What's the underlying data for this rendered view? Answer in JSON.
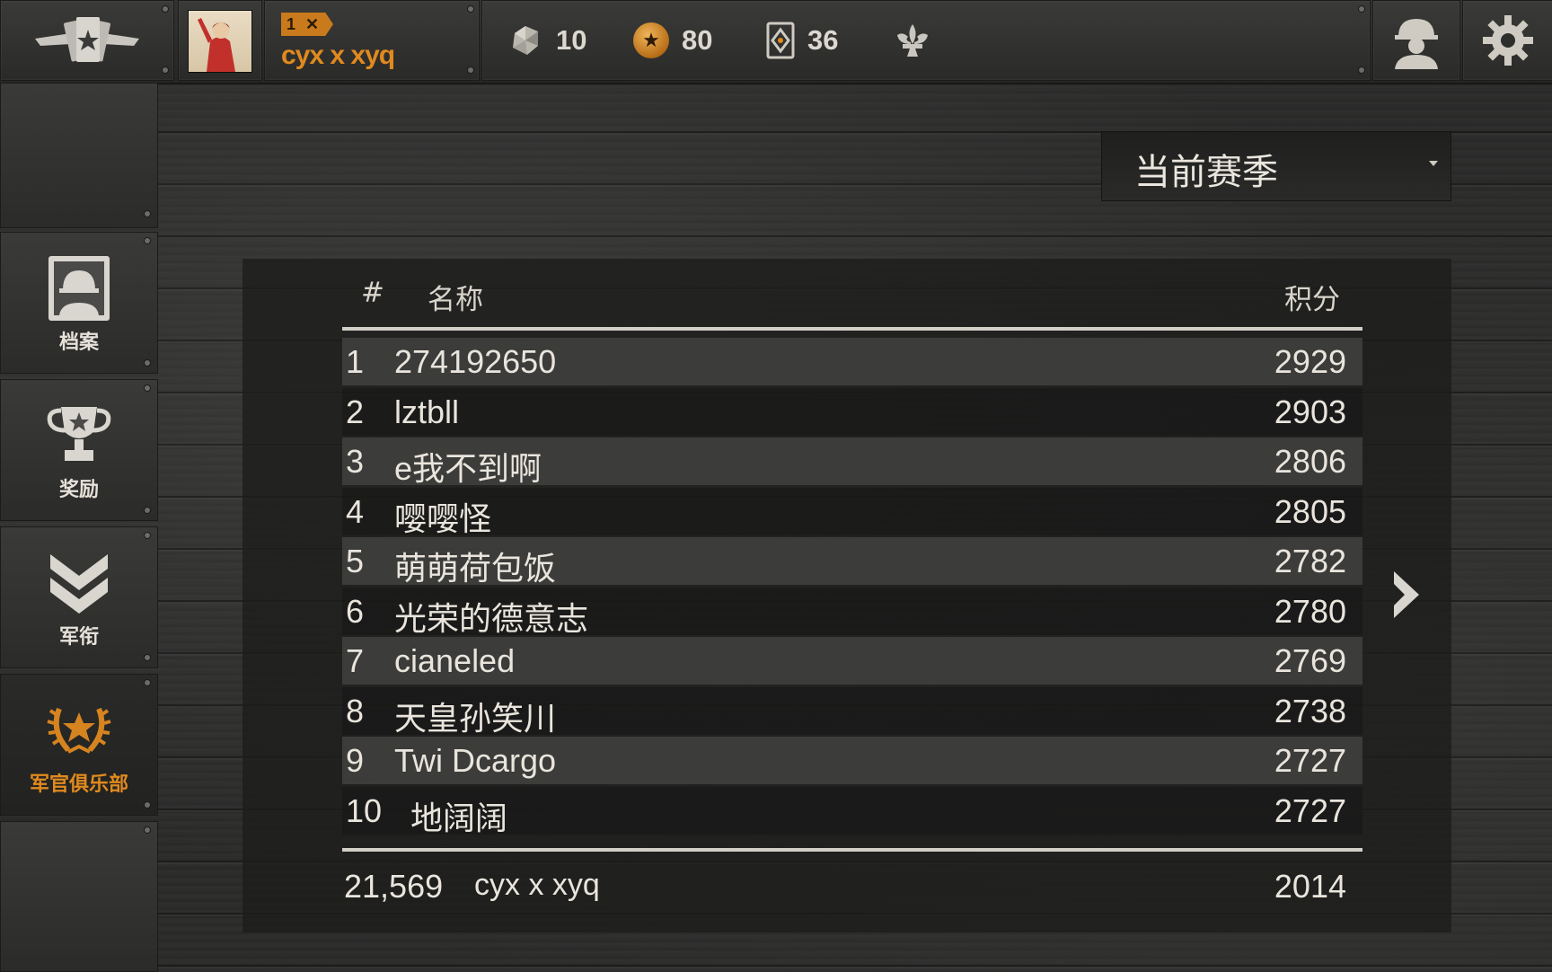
{
  "player": {
    "level": "1",
    "level_mark": "✕",
    "name": "cyx x xyq"
  },
  "resources": [
    {
      "icon": "gem-icon",
      "value": "10"
    },
    {
      "icon": "coin-icon",
      "value": "80"
    },
    {
      "icon": "card-icon",
      "value": "36"
    }
  ],
  "sidebar": {
    "items": [
      {
        "label": "档案",
        "icon": "profile-icon"
      },
      {
        "label": "奖励",
        "icon": "trophy-icon"
      },
      {
        "label": "军衔",
        "icon": "rank-chevron-icon"
      },
      {
        "label": "军官俱乐部",
        "icon": "officer-club-icon",
        "active": true
      }
    ]
  },
  "season": {
    "selected": "当前赛季"
  },
  "leaderboard": {
    "headers": {
      "rank": "#",
      "name": "名称",
      "score": "积分"
    },
    "rows": [
      {
        "rank": "1",
        "name": "274192650",
        "score": "2929"
      },
      {
        "rank": "2",
        "name": "lztbll",
        "score": "2903"
      },
      {
        "rank": "3",
        "name": "e我不到啊",
        "score": "2806"
      },
      {
        "rank": "4",
        "name": "嘤嘤怪",
        "score": "2805"
      },
      {
        "rank": "5",
        "name": "萌萌荷包饭",
        "score": "2782"
      },
      {
        "rank": "6",
        "name": "光荣的德意志",
        "score": "2780"
      },
      {
        "rank": "7",
        "name": "cianeled",
        "score": "2769"
      },
      {
        "rank": "8",
        "name": "天皇孙笑川",
        "score": "2738"
      },
      {
        "rank": "9",
        "name": "Twi Dcargo",
        "score": "2727"
      },
      {
        "rank": "10",
        "name": "地阔阔",
        "score": "2727"
      }
    ],
    "self": {
      "rank": "21,569",
      "name": "cyx x xyq",
      "score": "2014"
    }
  },
  "colors": {
    "accent_orange": "#e08a1e",
    "text_light": "#e9e5dd",
    "row_light": "#464645",
    "background": "#2c2c2b"
  }
}
